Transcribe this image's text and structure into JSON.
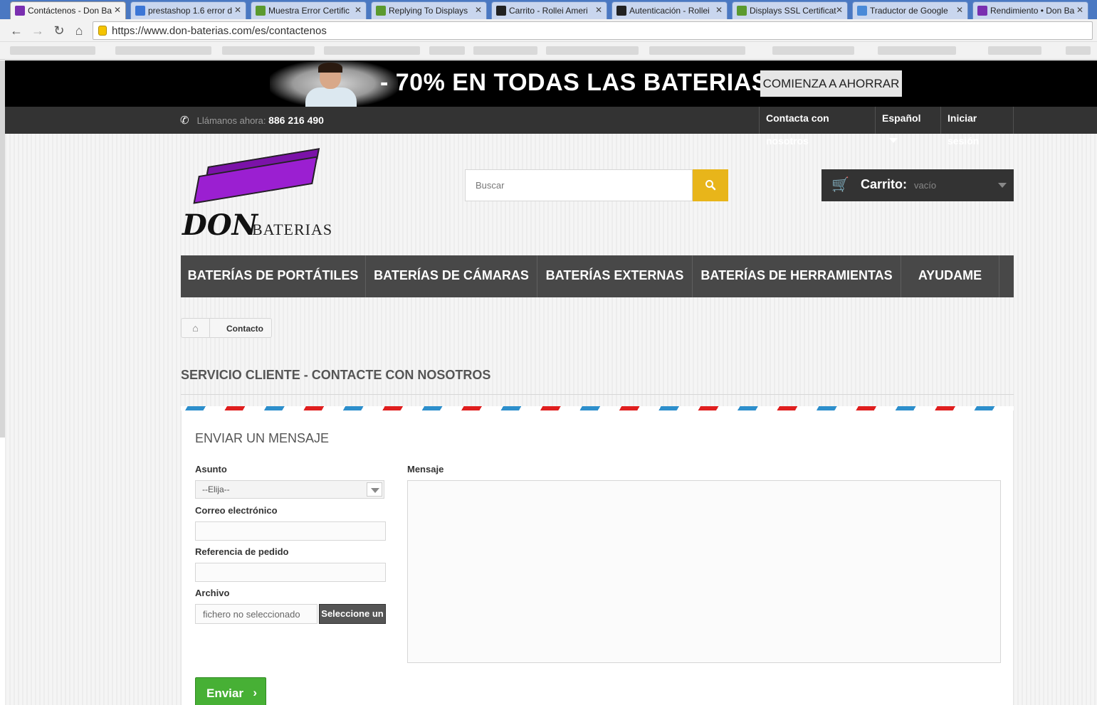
{
  "browser": {
    "tabs": [
      {
        "title": "Contáctenos - Don Ba",
        "favicon_color": "#7a2fb0"
      },
      {
        "title": "prestashop 1.6 error d",
        "favicon_color": "#3c76d6"
      },
      {
        "title": "Muestra Error Certific",
        "favicon_color": "#5b9a2f"
      },
      {
        "title": "Replying To Displays",
        "favicon_color": "#5b9a2f"
      },
      {
        "title": "Carrito - Rollei Ameri",
        "favicon_color": "#222222"
      },
      {
        "title": "Autenticación - Rollei",
        "favicon_color": "#222222"
      },
      {
        "title": "Displays SSL Certificat",
        "favicon_color": "#5b9a2f"
      },
      {
        "title": "Traductor de Google",
        "favicon_color": "#4a8ad8"
      },
      {
        "title": "Rendimiento • Don Ba",
        "favicon_color": "#7a2fb0"
      }
    ],
    "close_glyph": "✕",
    "url": "https://www.don-baterias.com/es/contactenos",
    "nav": {
      "back": "←",
      "forward": "→",
      "reload": "↻",
      "home": "⌂"
    }
  },
  "promo": {
    "headline": "- 70% EN TODAS LAS BATERIAS",
    "cta_label": "COMIENZA A AHORRAR"
  },
  "topbar": {
    "phone_icon": "✆",
    "phone_label": "Llámanos ahora:",
    "phone_number": "886 216 490",
    "contact_link": "Contacta con nosotros",
    "language": "Español",
    "login": "Iniciar sesión"
  },
  "logo": {
    "don": "DON",
    "baterias": "BATERIAS"
  },
  "search": {
    "placeholder": "Buscar",
    "icon": "search-icon"
  },
  "cart": {
    "icon": "🛒",
    "label": "Carrito:",
    "value": "vacío"
  },
  "menu": [
    "BATERÍAS DE PORTÁTILES",
    "BATERÍAS DE CÁMARAS",
    "BATERÍAS EXTERNAS",
    "BATERÍAS DE HERRAMIENTAS",
    "AYUDAME"
  ],
  "breadcrumb": {
    "home_icon": "⌂",
    "current": "Contacto"
  },
  "page_title": "SERVICIO CLIENTE - CONTACTE CON NOSOTROS",
  "form": {
    "heading": "ENVIAR UN MENSAJE",
    "subject_label": "Asunto",
    "subject_value": "--Elija--",
    "email_label": "Correo electrónico",
    "order_label": "Referencia de pedido",
    "file_label": "Archivo",
    "file_status": "fichero no seleccionado",
    "file_button": "Seleccione un",
    "message_label": "Mensaje",
    "send_label": "Enviar",
    "send_icon": "›"
  },
  "colors": {
    "accent": "#e8b51a",
    "send": "#47b035",
    "brand_purple": "#9b1fd1"
  }
}
